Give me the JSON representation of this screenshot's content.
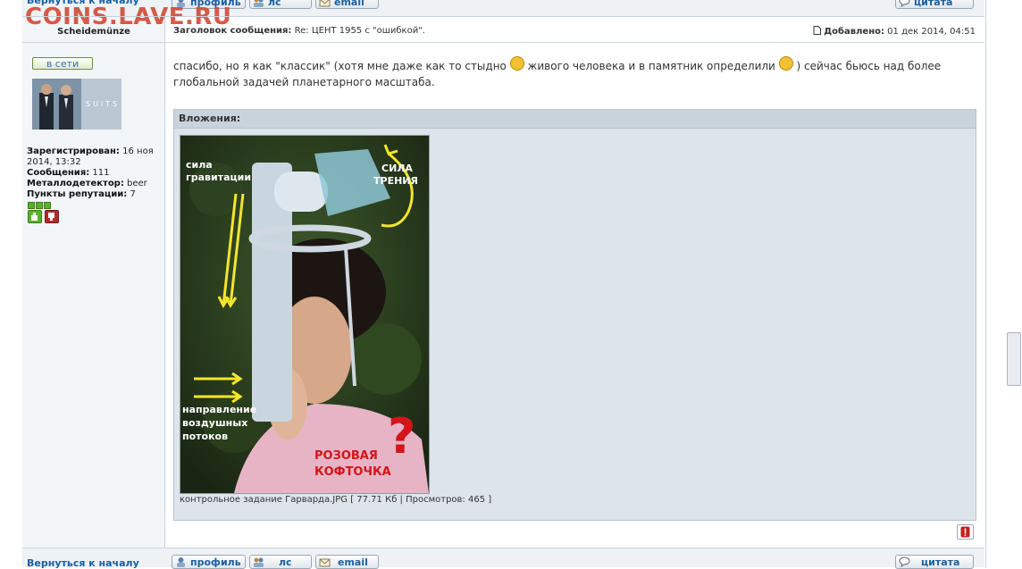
{
  "watermark": "COINS.LAVE.RU",
  "back_to_top": "Вернуться к началу",
  "buttons": {
    "profile": "профиль",
    "pm": "лс",
    "email": "email",
    "quote": "цитата"
  },
  "post": {
    "author": "Scheidemünze",
    "subject_label": "Заголовок сообщения:",
    "subject": "Re: ЦЕНТ 1955 с \"ошибкой\".",
    "added_label": "Добавлено:",
    "added": "01 дек 2014, 04:51",
    "message_part1": "спасибо, но я как \"классик\" (хотя мне даже как то стыдно",
    "message_part2": "живого человека и в памятник определили",
    "message_part3": ") сейчас бьюсь над более глобальной задачей планетарного масштаба.",
    "smile1": "blush-smile-icon",
    "smile2": "laugh-smile-icon"
  },
  "user": {
    "online": "в сети",
    "avatar_text": "SUITS",
    "registered_label": "Зарегистрирован:",
    "registered": "16 ноя 2014, 13:32",
    "messages_label": "Сообщения:",
    "messages": "111",
    "detector_label": "Металлодетектор:",
    "detector": "beer",
    "rep_label": "Пункты репутации:",
    "rep": "7",
    "rep_level": 3
  },
  "attachments": {
    "title": "Вложения:",
    "filename": "контрольное задание Гарварда.JPG",
    "size": "77.71 Кб",
    "views_label": "Просмотров:",
    "views": "465",
    "image_labels": {
      "gravity": "сила\nгравитации",
      "friction": "СИЛА\nТРЕНИЯ",
      "airflow": "направление\nвоздушных\nпотоков",
      "jacket": "РОЗОВАЯ\nКОФТОЧКА",
      "question": "?"
    }
  },
  "colors": {
    "link": "#1a5fa0",
    "watermark": "#d24a36",
    "panel": "#dde4ea"
  }
}
